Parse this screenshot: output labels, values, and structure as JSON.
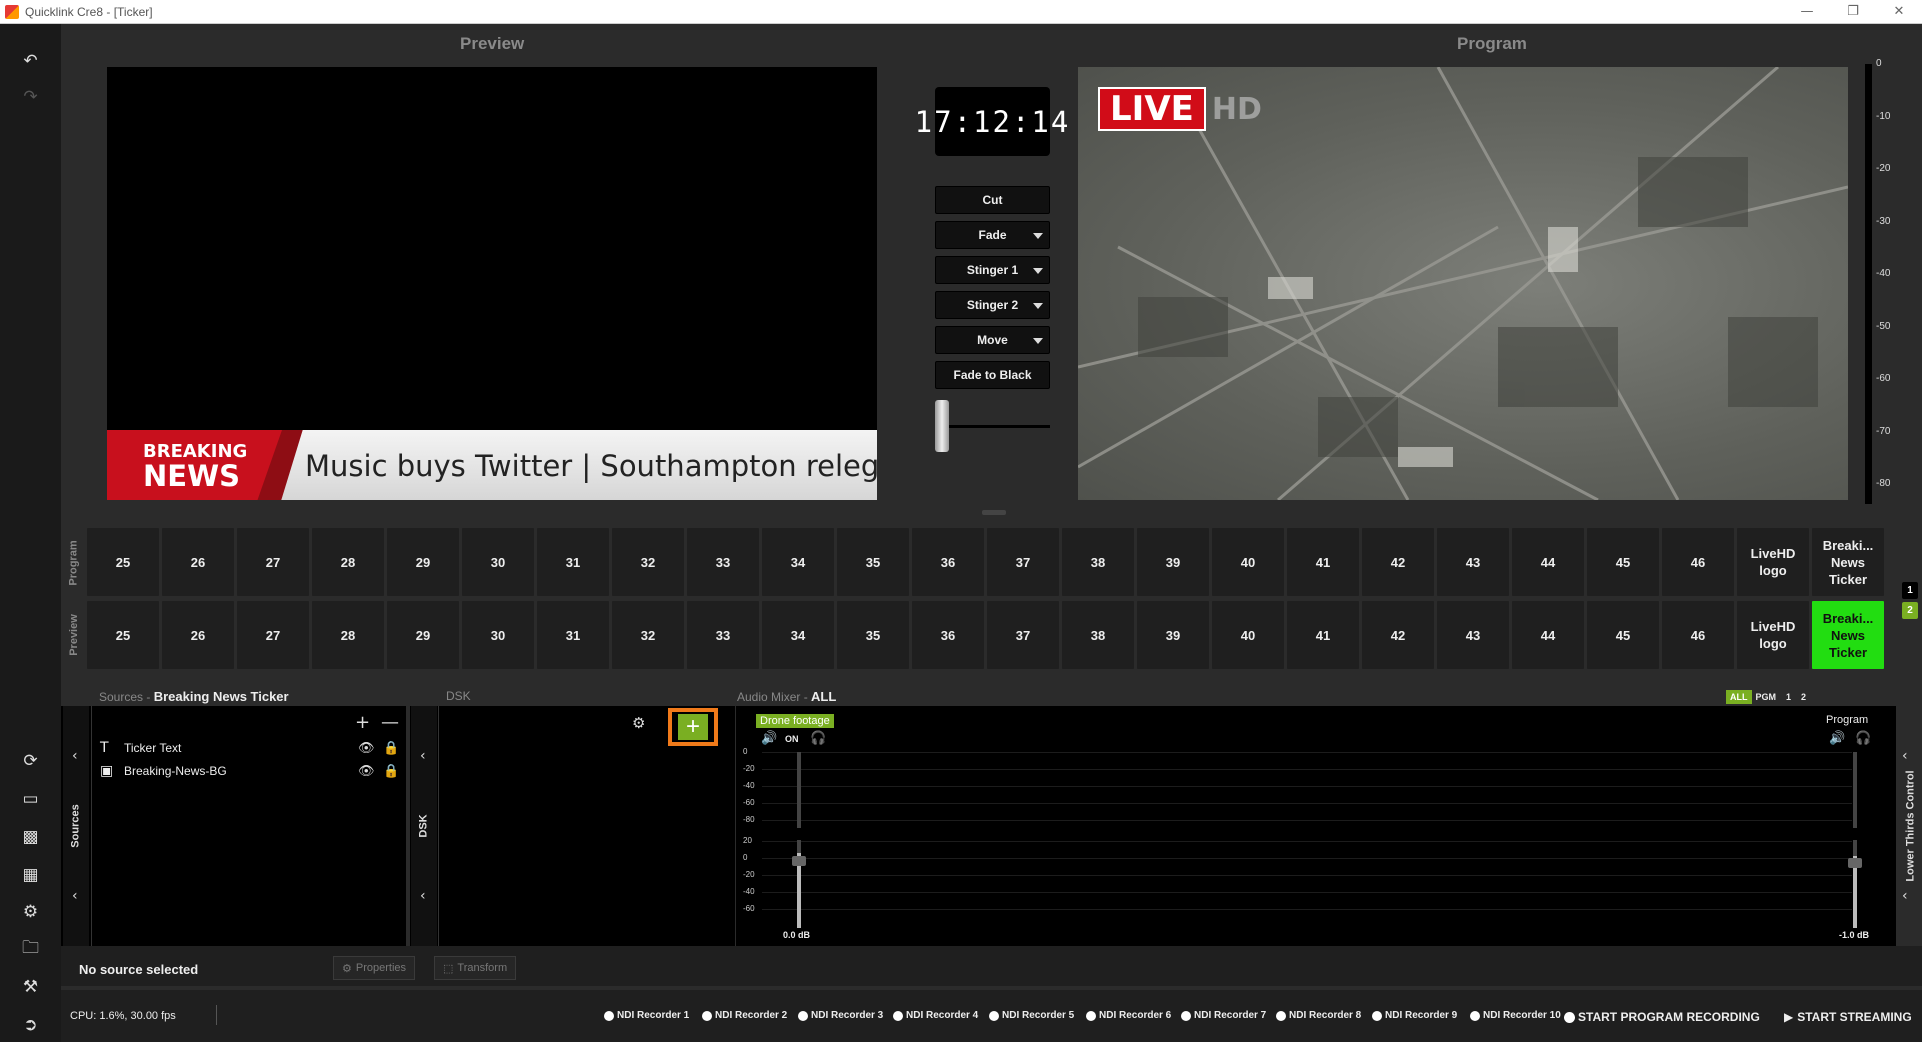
{
  "window": {
    "title": "Quicklink Cre8 - [Ticker]",
    "minimize": "—",
    "restore": "❐",
    "close": "✕"
  },
  "panels": {
    "preview_label": "Preview",
    "program_label": "Program"
  },
  "preview": {
    "ticker_badge_line1": "BREAKING",
    "ticker_badge_line2": "NEWS",
    "ticker_text": "Music buys Twitter  |  Southampton relegat"
  },
  "program": {
    "live_label": "LIVE",
    "hd_label": "HD"
  },
  "clock": "17:12:14",
  "transitions": {
    "cut": "Cut",
    "fade": "Fade",
    "stinger1": "Stinger 1",
    "stinger2": "Stinger 2",
    "move": "Move",
    "fade_to_black": "Fade to Black"
  },
  "vu_scale": [
    "0",
    "-10",
    "-20",
    "-30",
    "-40",
    "-50",
    "-60",
    "-70",
    "-80"
  ],
  "switcher": {
    "program_label": "Program",
    "preview_label": "Preview",
    "program_cells": [
      "25",
      "26",
      "27",
      "28",
      "29",
      "30",
      "31",
      "32",
      "33",
      "34",
      "35",
      "36",
      "37",
      "38",
      "39",
      "40",
      "41",
      "42",
      "43",
      "44",
      "45",
      "46",
      "LiveHD logo",
      "Breaki... News Ticker"
    ],
    "preview_cells": [
      "25",
      "26",
      "27",
      "28",
      "29",
      "30",
      "31",
      "32",
      "33",
      "34",
      "35",
      "36",
      "37",
      "38",
      "39",
      "40",
      "41",
      "42",
      "43",
      "44",
      "45",
      "46",
      "LiveHD logo",
      "Breaki... News Ticker"
    ],
    "active_preview_index": 23,
    "page_1": "1",
    "page_2": "2"
  },
  "sources": {
    "header_label": "Sources",
    "header_sep": "-",
    "scene_name": "Breaking News Ticker",
    "tab_label": "Sources",
    "items": [
      {
        "name": "Ticker Text",
        "icon": "text-icon"
      },
      {
        "name": "Breaking-News-BG",
        "icon": "image-icon"
      }
    ]
  },
  "dsk": {
    "header_label": "DSK",
    "tab_label": "DSK"
  },
  "audio": {
    "header_label": "Audio Mixer",
    "header_sep": "-",
    "scope": "ALL",
    "filter_all": "ALL",
    "filter_pgm": "PGM",
    "filter_1": "1",
    "filter_2": "2",
    "channel_name": "Drone footage",
    "channel_on": "ON",
    "channel_db": "0.0 dB",
    "program_name": "Program",
    "program_db": "-1.0 dB",
    "scale_top": [
      "0",
      "-20",
      "-40",
      "-60",
      "-80"
    ],
    "scale_bottom": [
      "20",
      "0",
      "-20",
      "-40",
      "-60"
    ],
    "channel_level": 0.85,
    "program_level": 0.82
  },
  "lower_thirds": {
    "tab_label": "Lower Thirds Control"
  },
  "status": {
    "no_source": "No source selected",
    "properties": "Properties",
    "transform": "Transform",
    "cpu": "CPU: 1.6%, 30.00 fps",
    "recorders": [
      "NDI Recorder 1",
      "NDI Recorder 2",
      "NDI Recorder 3",
      "NDI Recorder 4",
      "NDI Recorder 5",
      "NDI Recorder 6",
      "NDI Recorder 7",
      "NDI Recorder 8",
      "NDI Recorder 9",
      "NDI Recorder 10"
    ],
    "start_recording": "START PROGRAM RECORDING",
    "start_streaming": "START STREAMING"
  },
  "colors": {
    "accent_green": "#22dd11",
    "audio_green": "#7aaf22",
    "highlight_orange": "#f07a1a",
    "live_red": "#d10c18"
  }
}
